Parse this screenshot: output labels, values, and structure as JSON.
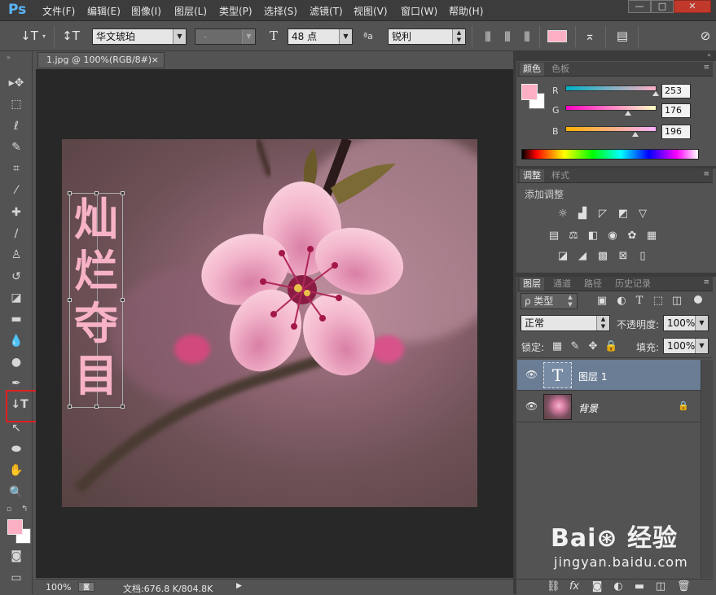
{
  "app": {
    "logo": "Ps"
  },
  "menu": [
    "文件(F)",
    "编辑(E)",
    "图像(I)",
    "图层(L)",
    "类型(P)",
    "选择(S)",
    "滤镜(T)",
    "视图(V)",
    "窗口(W)",
    "帮助(H)"
  ],
  "window_controls": {
    "minimize": "—",
    "maximize": "□",
    "close": "✕"
  },
  "options": {
    "font_family": "华文琥珀",
    "font_style": "-",
    "font_size": "48 点",
    "aa_label": "ªa",
    "antialias": "锐利"
  },
  "document": {
    "tab_title": "1.jpg @ 100%(RGB/8#)",
    "close_icon": "×"
  },
  "canvas_text": [
    "灿",
    "烂",
    "夺",
    "目"
  ],
  "status": {
    "zoom": "100%",
    "doc_info": "文档:676.8 K/804.8K"
  },
  "color_panel": {
    "tabs": [
      "颜色",
      "色板"
    ],
    "r_label": "R",
    "g_label": "G",
    "b_label": "B",
    "r": "253",
    "g": "176",
    "b": "196",
    "foreground": "#fdb0c4",
    "r_fraction": 0.992,
    "g_fraction": 0.69,
    "b_fraction": 0.769
  },
  "adjust_panel": {
    "tabs": [
      "调整",
      "样式"
    ],
    "title": "添加调整"
  },
  "layers_panel": {
    "tabs": [
      "图层",
      "通道",
      "路径",
      "历史记录"
    ],
    "filter_label": "ρ 类型",
    "blend_mode": "正常",
    "opacity_label": "不透明度:",
    "opacity": "100%",
    "lock_label": "锁定:",
    "fill_label": "填充:",
    "fill": "100%",
    "layers": [
      {
        "name": "图层 1",
        "thumb": "T",
        "selected": true
      },
      {
        "name": "背景",
        "selected": false
      }
    ]
  },
  "colors": {
    "accent_blue": "#5ab5f6",
    "highlight_red": "#e02020",
    "selected_layer": "#6a7d95"
  }
}
